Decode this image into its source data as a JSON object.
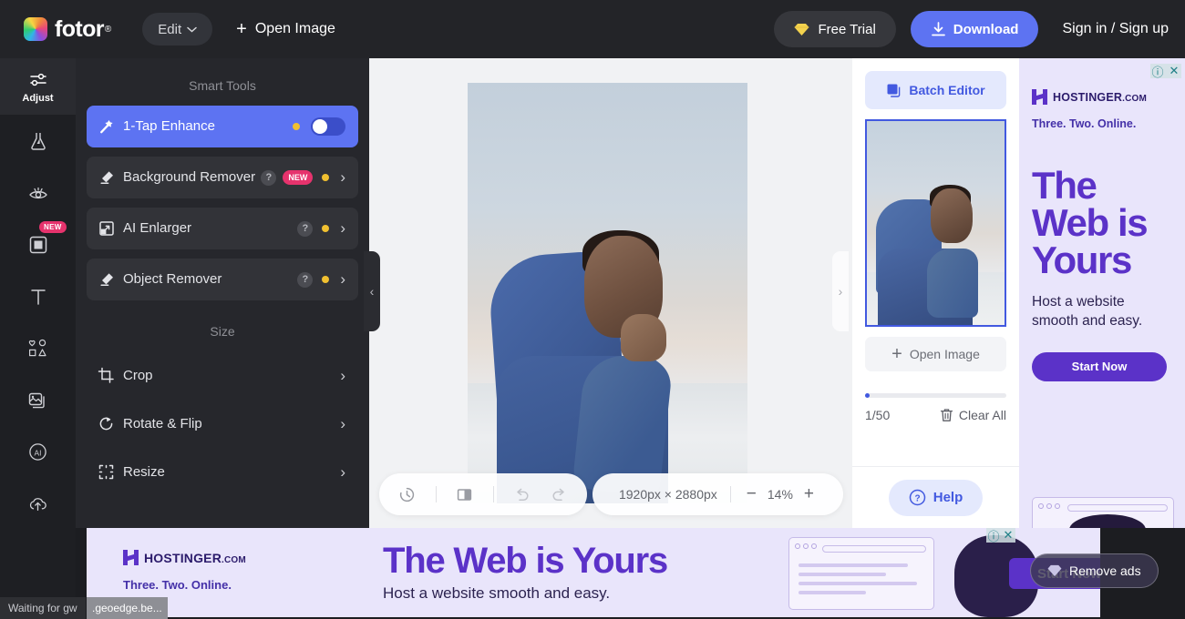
{
  "header": {
    "logo_text": "fotor",
    "logo_reg": "®",
    "edit_label": "Edit",
    "open_image_label": "Open Image",
    "free_trial_label": "Free Trial",
    "download_label": "Download",
    "signin_label": "Sign in / Sign up",
    "accent_color": "#5d73f2"
  },
  "rail": {
    "items": [
      {
        "label": "Adjust",
        "icon": "sliders-icon",
        "active": true,
        "badge": ""
      },
      {
        "label": "",
        "icon": "flask-effects-icon",
        "active": false,
        "badge": ""
      },
      {
        "label": "",
        "icon": "eye-beauty-icon",
        "active": false,
        "badge": ""
      },
      {
        "label": "",
        "icon": "frame-icon",
        "active": false,
        "badge": "NEW"
      },
      {
        "label": "",
        "icon": "text-icon",
        "active": false,
        "badge": ""
      },
      {
        "label": "",
        "icon": "elements-icon",
        "active": false,
        "badge": ""
      },
      {
        "label": "",
        "icon": "collage-icon",
        "active": false,
        "badge": ""
      },
      {
        "label": "",
        "icon": "ai-icon",
        "active": false,
        "badge": ""
      },
      {
        "label": "",
        "icon": "cloud-upload-icon",
        "active": false,
        "badge": ""
      }
    ]
  },
  "tools": {
    "smart_tools_title": "Smart Tools",
    "smart_tools": [
      {
        "label": "1-Tap Enhance",
        "icon": "magic-wand-icon",
        "active": true,
        "has_help": false,
        "badge": "",
        "premium": true,
        "control": "toggle",
        "toggle_on": true
      },
      {
        "label": "Background Remover",
        "icon": "eraser-icon",
        "active": false,
        "has_help": true,
        "badge": "NEW",
        "premium": true,
        "control": "chevron",
        "toggle_on": false
      },
      {
        "label": "AI Enlarger",
        "icon": "enlarge-icon",
        "active": false,
        "has_help": true,
        "badge": "",
        "premium": true,
        "control": "chevron",
        "toggle_on": false
      },
      {
        "label": "Object Remover",
        "icon": "eraser-icon",
        "active": false,
        "has_help": true,
        "badge": "",
        "premium": true,
        "control": "chevron",
        "toggle_on": false
      }
    ],
    "size_title": "Size",
    "size_items": [
      {
        "label": "Crop",
        "icon": "crop-icon"
      },
      {
        "label": "Rotate & Flip",
        "icon": "rotate-icon"
      },
      {
        "label": "Resize",
        "icon": "resize-icon"
      }
    ],
    "help_mark": "?",
    "new_badge": "NEW",
    "premium_dot_color": "#f0c030",
    "badge_color": "#e6336d"
  },
  "canvas": {
    "collapse_left_icon": "chevron-left-icon",
    "collapse_right_icon": "chevron-right-icon",
    "toolbar": {
      "history_icon": "history-icon",
      "compare_icon": "compare-icon",
      "undo_icon": "undo-icon",
      "redo_icon": "redo-icon",
      "dimensions": "1920px × 2880px",
      "zoom_out": "−",
      "zoom_level": "14%",
      "zoom_in": "+"
    }
  },
  "batch": {
    "batch_editor_label": "Batch Editor",
    "open_image_label": "Open Image",
    "count": "1/50",
    "clear_all_label": "Clear All",
    "help_label": "Help",
    "help_icon": "question-circle-icon",
    "trash_icon": "trash-icon",
    "batch_icon": "layers-icon",
    "accent_color": "#4259e0"
  },
  "ad_side": {
    "brand_main": "HOSTINGER",
    "brand_tld": ".COM",
    "tagline": "Three. Two. Online.",
    "headline_line1": "The",
    "headline_line2": "Web is",
    "headline_line3": "Yours",
    "subtext_line1": "Host a website",
    "subtext_line2": "smooth and easy.",
    "cta_label": "Start Now",
    "info_icon": "info-icon",
    "close_icon": "close-icon",
    "brand_color": "#5b32c8",
    "bg_color": "#e9e5fb"
  },
  "ad_bottom": {
    "brand_main": "HOSTINGER",
    "brand_tld": ".COM",
    "tagline": "Three. Two. Online.",
    "headline": "The Web is Yours",
    "subtext": "Host a website smooth and easy.",
    "cta_label": "Start Now",
    "info_icon": "info-icon",
    "close_icon": "close-icon"
  },
  "remove_ads": {
    "label": "Remove ads",
    "icon": "diamond-icon"
  },
  "status": {
    "text_left": "Waiting for gw",
    "text_right": ".geoedge.be..."
  }
}
